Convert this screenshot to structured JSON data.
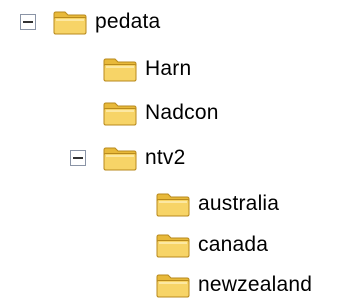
{
  "tree": {
    "root": {
      "label": "pedata",
      "expanded": true,
      "children": [
        {
          "label": "Harn"
        },
        {
          "label": "Nadcon"
        },
        {
          "label": "ntv2",
          "expanded": true,
          "children": [
            {
              "label": "australia"
            },
            {
              "label": "canada"
            },
            {
              "label": "newzealand"
            }
          ]
        }
      ]
    }
  },
  "icons": {
    "folder": "folder-icon",
    "collapse": "collapse-minus-icon"
  },
  "colors": {
    "folder_fill": "#f5cf55",
    "folder_dark": "#c9941a",
    "folder_light": "#fde9a4",
    "toggle_border": "#8a94a6"
  }
}
